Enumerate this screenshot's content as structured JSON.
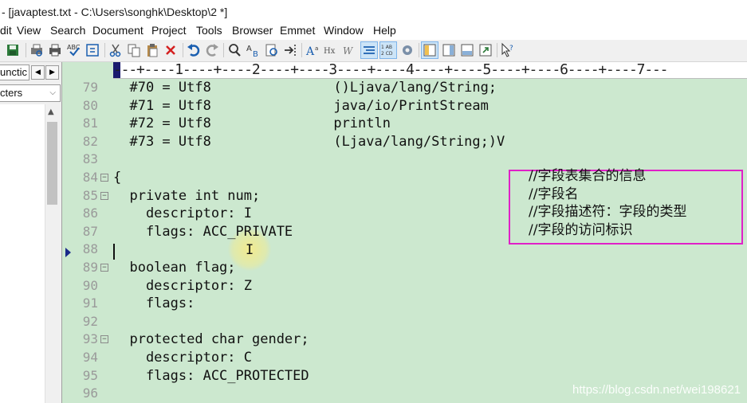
{
  "window": {
    "title": "- [javaptest.txt - C:\\Users\\songhk\\Desktop\\2 *]"
  },
  "menu": [
    "dit",
    "View",
    "Search",
    "Document",
    "Project",
    "Tools",
    "Browser",
    "Emmet",
    "Window",
    "Help"
  ],
  "toolbar_icons": [
    "save-all-icon",
    "print-preview-icon",
    "print-icon",
    "spellcheck-icon",
    "sync-icon",
    "cut-icon",
    "copy-icon",
    "paste-icon",
    "delete-icon",
    "undo-icon",
    "redo-icon",
    "find-icon",
    "replace-icon",
    "find-in-files-icon",
    "jump-icon",
    "font-size-icon",
    "hex-icon",
    "word-wrap-icon",
    "indent-guide-icon",
    "line-number-icon",
    "settings-icon",
    "left-panel-icon",
    "right-panel-icon",
    "output-panel-icon",
    "fullscreen-icon",
    "help-cursor-icon"
  ],
  "left_panel": {
    "tab_label": "unctic",
    "filter_label": "cters"
  },
  "editor": {
    "ruler": "---+----1----+----2----+----3----+----4----+----5----+----6----+----7---",
    "lines": [
      {
        "num": "79",
        "code": "  #70 = Utf8               ()Ljava/lang/String;"
      },
      {
        "num": "80",
        "code": "  #71 = Utf8               java/io/PrintStream"
      },
      {
        "num": "81",
        "code": "  #72 = Utf8               println"
      },
      {
        "num": "82",
        "code": "  #73 = Utf8               (Ljava/lang/String;)V"
      },
      {
        "num": "83",
        "code": ""
      },
      {
        "num": "84",
        "code": "{",
        "fold": true
      },
      {
        "num": "85",
        "code": "  private int num;",
        "fold": true
      },
      {
        "num": "86",
        "code": "    descriptor: I"
      },
      {
        "num": "87",
        "code": "    flags: ACC_PRIVATE"
      },
      {
        "num": "88",
        "code": ""
      },
      {
        "num": "89",
        "code": "  boolean flag;",
        "fold": true
      },
      {
        "num": "90",
        "code": "    descriptor: Z"
      },
      {
        "num": "91",
        "code": "    flags:"
      },
      {
        "num": "92",
        "code": ""
      },
      {
        "num": "93",
        "code": "  protected char gender;",
        "fold": true
      },
      {
        "num": "94",
        "code": "    descriptor: C"
      },
      {
        "num": "95",
        "code": "    flags: ACC_PROTECTED"
      },
      {
        "num": "96",
        "code": ""
      }
    ],
    "annotations": [
      "//字段表集合的信息",
      "//字段名",
      "//字段描述符：字段的类型",
      "//字段的访问标识"
    ],
    "annotation_color": "#e020c8",
    "background_color": "#cce8cf"
  },
  "watermark": "https://blog.csdn.net/wei198621"
}
